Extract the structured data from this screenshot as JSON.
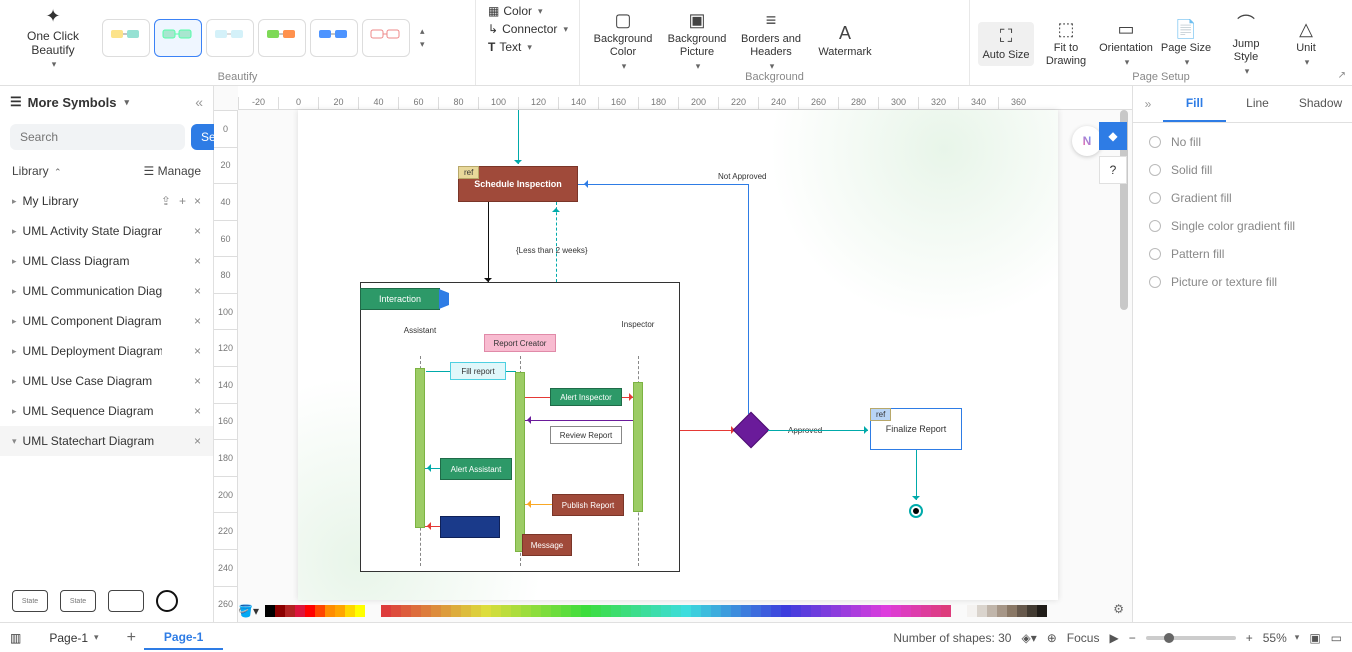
{
  "ribbon": {
    "one_click": "One Click Beautify",
    "beautify_label": "Beautify",
    "color": "Color",
    "connector": "Connector",
    "text": "Text",
    "bg_color": "Background Color",
    "bg_picture": "Background Picture",
    "borders": "Borders and Headers",
    "watermark": "Watermark",
    "background_label": "Background",
    "auto_size": "Auto Size",
    "fit": "Fit to Drawing",
    "orientation": "Orientation",
    "page_size": "Page Size",
    "jump_style": "Jump Style",
    "unit": "Unit",
    "page_setup_label": "Page Setup"
  },
  "left": {
    "title": "More Symbols",
    "search_ph": "Search",
    "search_btn": "Search",
    "library": "Library",
    "manage": "Manage",
    "items": [
      "My Library",
      "UML Activity State Diagram",
      "UML Class Diagram",
      "UML Communication Diagr...",
      "UML Component Diagram",
      "UML Deployment Diagram",
      "UML Use Case Diagram",
      "UML Sequence Diagram",
      "UML Statechart Diagram"
    ]
  },
  "ruler_h": [
    "-20",
    "0",
    "20",
    "40",
    "60",
    "80",
    "100",
    "120",
    "140",
    "160",
    "180",
    "200",
    "220",
    "240",
    "260",
    "280",
    "300",
    "320",
    "340",
    "360"
  ],
  "ruler_v": [
    "0",
    "20",
    "40",
    "60",
    "80",
    "100",
    "120",
    "140",
    "160",
    "180",
    "200",
    "220",
    "240",
    "260"
  ],
  "diagram": {
    "schedule": "Schedule Inspection",
    "ref": "ref",
    "less2w": "{Less than 2 weeks}",
    "not_approved": "Not Approved",
    "interaction": "Interaction",
    "assistant": "Assistant",
    "report_creator": "Report Creator",
    "inspector": "Inspector",
    "fill_report": "Fill report",
    "alert_inspector": "Alert Inspector",
    "review_report": "Review Report",
    "alert_assistant": "Alert Assistant",
    "publish_report": "Publish Report",
    "message": "Message",
    "approved": "Approved",
    "finalize": "Finalize Report"
  },
  "right": {
    "tabs": [
      "Fill",
      "Line",
      "Shadow"
    ],
    "opts": [
      "No fill",
      "Solid fill",
      "Gradient fill",
      "Single color gradient fill",
      "Pattern fill",
      "Picture or texture fill"
    ]
  },
  "bottom": {
    "page": "Page-1",
    "page_tab": "Page-1",
    "shapes": "Number of shapes: 30",
    "focus": "Focus",
    "zoom": "55%"
  }
}
